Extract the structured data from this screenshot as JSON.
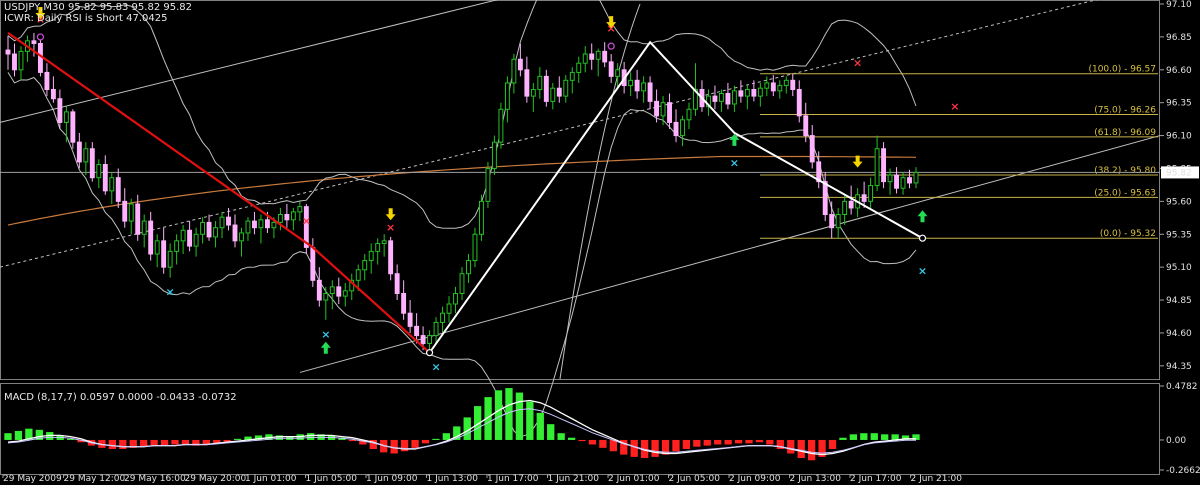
{
  "header": {
    "symbol_line": "USDJPY,M30  95.82 95.83 95.82 95.82",
    "rsi_line": "ICWR: Daily RSI is Short 47.0425"
  },
  "macd_label": "MACD  (8,17,7) 0.0597 0.0000 -0.0433 -0.0732",
  "colors": {
    "background": "#000000",
    "candle_up": "#22c322",
    "candle_down": "#ffb3ff",
    "wave_red": "#e01010",
    "wave_white": "#ffffff",
    "fib_line": "#c8b44a",
    "moving_average": "#c87a3c",
    "bollinger": "#c0c0c0",
    "macd_up": "#33ee33",
    "macd_down": "#ff2020",
    "current_price": "#ffffff"
  },
  "chart_data": [
    {
      "type": "candlestick",
      "title": "USDJPY,M30",
      "ylim": [
        94.25,
        97.1
      ],
      "y_ticks": [
        "97.10",
        "96.85",
        "96.60",
        "96.35",
        "96.10",
        "95.85",
        "95.60",
        "95.35",
        "95.10",
        "94.85",
        "94.60",
        "94.35"
      ],
      "x_ticks": [
        "29 May 2009",
        "29 May 12:00",
        "29 May 16:00",
        "29 May 20:00",
        "1 Jun 01:00",
        "1 Jun 05:00",
        "1 Jun 09:00",
        "1 Jun 13:00",
        "1 Jun 17:00",
        "1 Jun 21:00",
        "2 Jun 01:00",
        "2 Jun 05:00",
        "2 Jun 09:00",
        "2 Jun 13:00",
        "2 Jun 17:00",
        "2 Jun 21:00"
      ],
      "current_price": 95.82,
      "current_price_label": "95.82",
      "fibonacci_levels": [
        {
          "label": "(100.0) - 96.57",
          "value": 96.57
        },
        {
          "label": "(75.0) - 96.26",
          "value": 96.26
        },
        {
          "label": "(61.8) - 96.09",
          "value": 96.09
        },
        {
          "label": "(38.2) - 95.80",
          "value": 95.8
        },
        {
          "label": "(25.0) - 95.63",
          "value": 95.63
        },
        {
          "label": "(0.0) - 95.32",
          "value": 95.32
        }
      ],
      "zigzag_red": [
        [
          0,
          96.88
        ],
        [
          47,
          95.25
        ],
        [
          65,
          94.45
        ]
      ],
      "zigzag_white": [
        [
          65,
          94.45
        ],
        [
          99,
          96.81
        ],
        [
          112,
          96.12
        ],
        [
          141,
          95.32
        ]
      ],
      "swing_highs": [
        [
          5,
          96.88
        ],
        [
          46,
          95.35
        ],
        [
          59,
          95.3
        ],
        [
          93,
          96.81
        ],
        [
          131,
          96.55
        ],
        [
          146,
          96.22
        ]
      ],
      "swing_lows": [
        [
          25,
          95.02
        ],
        [
          49,
          94.7
        ],
        [
          66,
          94.45
        ],
        [
          112,
          96.0
        ],
        [
          141,
          95.18
        ]
      ],
      "arrows_down": [
        5,
        59,
        93,
        131
      ],
      "arrows_up": [
        49,
        112,
        141
      ],
      "ohlc": [
        [
          96.75,
          96.86,
          96.6,
          96.72
        ],
        [
          96.72,
          96.8,
          96.55,
          96.6
        ],
        [
          96.6,
          96.78,
          96.52,
          96.74
        ],
        [
          96.74,
          96.86,
          96.66,
          96.82
        ],
        [
          96.82,
          96.88,
          96.7,
          96.8
        ],
        [
          96.8,
          96.85,
          96.55,
          96.58
        ],
        [
          96.58,
          96.65,
          96.4,
          96.45
        ],
        [
          96.45,
          96.55,
          96.35,
          96.38
        ],
        [
          96.38,
          96.45,
          96.15,
          96.2
        ],
        [
          96.2,
          96.32,
          96.05,
          96.28
        ],
        [
          96.28,
          96.3,
          96.0,
          96.05
        ],
        [
          96.05,
          96.12,
          95.85,
          95.9
        ],
        [
          95.9,
          96.05,
          95.8,
          96.0
        ],
        [
          96.0,
          96.05,
          95.75,
          95.78
        ],
        [
          95.78,
          95.92,
          95.7,
          95.88
        ],
        [
          95.88,
          95.95,
          95.65,
          95.68
        ],
        [
          95.68,
          95.82,
          95.58,
          95.78
        ],
        [
          95.78,
          95.85,
          95.55,
          95.6
        ],
        [
          95.6,
          95.7,
          95.4,
          95.45
        ],
        [
          95.45,
          95.62,
          95.35,
          95.58
        ],
        [
          95.58,
          95.65,
          95.3,
          95.35
        ],
        [
          95.35,
          95.5,
          95.25,
          95.45
        ],
        [
          95.45,
          95.52,
          95.15,
          95.2
        ],
        [
          95.2,
          95.35,
          95.1,
          95.3
        ],
        [
          95.3,
          95.4,
          95.05,
          95.1
        ],
        [
          95.1,
          95.28,
          95.02,
          95.22
        ],
        [
          95.22,
          95.35,
          95.12,
          95.3
        ],
        [
          95.3,
          95.42,
          95.2,
          95.38
        ],
        [
          95.38,
          95.45,
          95.22,
          95.26
        ],
        [
          95.26,
          95.4,
          95.18,
          95.35
        ],
        [
          95.35,
          95.48,
          95.28,
          95.44
        ],
        [
          95.44,
          95.5,
          95.3,
          95.33
        ],
        [
          95.33,
          95.45,
          95.25,
          95.4
        ],
        [
          95.4,
          95.52,
          95.32,
          95.48
        ],
        [
          95.48,
          95.55,
          95.38,
          95.42
        ],
        [
          95.42,
          95.5,
          95.25,
          95.3
        ],
        [
          95.3,
          95.4,
          95.18,
          95.36
        ],
        [
          95.36,
          95.48,
          95.3,
          95.45
        ],
        [
          95.45,
          95.52,
          95.35,
          95.4
        ],
        [
          95.4,
          95.5,
          95.28,
          95.46
        ],
        [
          95.46,
          95.52,
          95.36,
          95.4
        ],
        [
          95.4,
          95.48,
          95.32,
          95.44
        ],
        [
          95.44,
          95.55,
          95.38,
          95.5
        ],
        [
          95.5,
          95.58,
          95.4,
          95.46
        ],
        [
          95.46,
          95.55,
          95.38,
          95.52
        ],
        [
          95.52,
          95.6,
          95.45,
          95.56
        ],
        [
          95.56,
          95.58,
          95.2,
          95.25
        ],
        [
          95.25,
          95.32,
          94.95,
          95.0
        ],
        [
          95.0,
          95.1,
          94.8,
          94.85
        ],
        [
          94.85,
          94.95,
          94.7,
          94.9
        ],
        [
          94.9,
          95.0,
          94.78,
          94.95
        ],
        [
          94.95,
          95.02,
          94.82,
          94.88
        ],
        [
          94.88,
          94.98,
          94.8,
          94.92
        ],
        [
          94.92,
          95.05,
          94.85,
          95.0
        ],
        [
          95.0,
          95.12,
          94.92,
          95.08
        ],
        [
          95.08,
          95.2,
          95.0,
          95.15
        ],
        [
          95.15,
          95.28,
          95.05,
          95.22
        ],
        [
          95.22,
          95.32,
          95.12,
          95.28
        ],
        [
          95.28,
          95.35,
          95.18,
          95.3
        ],
        [
          95.3,
          95.33,
          95.0,
          95.05
        ],
        [
          95.05,
          95.12,
          94.85,
          94.9
        ],
        [
          94.9,
          95.0,
          94.7,
          94.75
        ],
        [
          94.75,
          94.85,
          94.6,
          94.65
        ],
        [
          94.65,
          94.75,
          94.52,
          94.58
        ],
        [
          94.58,
          94.65,
          94.47,
          94.52
        ],
        [
          94.52,
          94.62,
          94.45,
          94.58
        ],
        [
          94.58,
          94.72,
          94.52,
          94.68
        ],
        [
          94.68,
          94.8,
          94.6,
          94.75
        ],
        [
          94.75,
          94.88,
          94.68,
          94.82
        ],
        [
          94.82,
          94.95,
          94.75,
          94.9
        ],
        [
          94.9,
          95.1,
          94.85,
          95.05
        ],
        [
          95.05,
          95.2,
          94.98,
          95.15
        ],
        [
          95.15,
          95.4,
          95.1,
          95.35
        ],
        [
          95.35,
          95.65,
          95.3,
          95.6
        ],
        [
          95.6,
          95.9,
          95.55,
          95.85
        ],
        [
          95.85,
          96.1,
          95.8,
          96.05
        ],
        [
          96.05,
          96.35,
          96.0,
          96.3
        ],
        [
          96.3,
          96.55,
          96.2,
          96.5
        ],
        [
          96.5,
          96.72,
          96.42,
          96.68
        ],
        [
          96.68,
          96.8,
          96.55,
          96.6
        ],
        [
          96.6,
          96.7,
          96.35,
          96.4
        ],
        [
          96.4,
          96.5,
          96.28,
          96.45
        ],
        [
          96.45,
          96.62,
          96.38,
          96.55
        ],
        [
          96.55,
          96.6,
          96.32,
          96.36
        ],
        [
          96.36,
          96.5,
          96.3,
          96.46
        ],
        [
          96.46,
          96.55,
          96.35,
          96.4
        ],
        [
          96.4,
          96.56,
          96.35,
          96.52
        ],
        [
          96.52,
          96.62,
          96.42,
          96.58
        ],
        [
          96.58,
          96.7,
          96.5,
          96.65
        ],
        [
          96.65,
          96.78,
          96.58,
          96.72
        ],
        [
          96.72,
          96.8,
          96.6,
          96.68
        ],
        [
          96.68,
          96.76,
          96.55,
          96.74
        ],
        [
          96.74,
          96.81,
          96.62,
          96.66
        ],
        [
          96.66,
          96.72,
          96.5,
          96.55
        ],
        [
          96.55,
          96.65,
          96.45,
          96.6
        ],
        [
          96.6,
          96.66,
          96.42,
          96.48
        ],
        [
          96.48,
          96.58,
          96.4,
          96.52
        ],
        [
          96.52,
          96.6,
          96.38,
          96.44
        ],
        [
          96.44,
          96.55,
          96.35,
          96.5
        ],
        [
          96.5,
          96.55,
          96.3,
          96.36
        ],
        [
          96.36,
          96.45,
          96.2,
          96.25
        ],
        [
          96.25,
          96.4,
          96.18,
          96.35
        ],
        [
          96.35,
          96.42,
          96.15,
          96.2
        ],
        [
          96.2,
          96.3,
          96.05,
          96.1
        ],
        [
          96.1,
          96.25,
          96.02,
          96.22
        ],
        [
          96.22,
          96.35,
          96.15,
          96.3
        ],
        [
          96.3,
          96.65,
          96.25,
          96.45
        ],
        [
          96.45,
          96.52,
          96.28,
          96.32
        ],
        [
          96.32,
          96.45,
          96.25,
          96.4
        ],
        [
          96.4,
          96.48,
          96.3,
          96.36
        ],
        [
          96.36,
          96.45,
          96.28,
          96.42
        ],
        [
          96.42,
          96.5,
          96.3,
          96.34
        ],
        [
          96.34,
          96.48,
          96.28,
          96.44
        ],
        [
          96.44,
          96.52,
          96.35,
          96.4
        ],
        [
          96.4,
          96.48,
          96.3,
          96.45
        ],
        [
          96.45,
          96.52,
          96.36,
          96.4
        ],
        [
          96.4,
          96.5,
          96.32,
          96.46
        ],
        [
          96.46,
          96.55,
          96.4,
          96.5
        ],
        [
          96.5,
          96.56,
          96.4,
          96.44
        ],
        [
          96.44,
          96.52,
          96.38,
          96.48
        ],
        [
          96.48,
          96.55,
          96.42,
          96.52
        ],
        [
          96.52,
          96.57,
          96.4,
          96.45
        ],
        [
          96.45,
          96.52,
          96.2,
          96.25
        ],
        [
          96.25,
          96.35,
          96.05,
          96.1
        ],
        [
          96.1,
          96.18,
          95.85,
          95.9
        ],
        [
          95.9,
          95.98,
          95.7,
          95.75
        ],
        [
          95.75,
          95.82,
          95.45,
          95.5
        ],
        [
          95.5,
          95.6,
          95.32,
          95.4
        ],
        [
          95.4,
          95.55,
          95.32,
          95.5
        ],
        [
          95.5,
          95.65,
          95.42,
          95.6
        ],
        [
          95.6,
          95.72,
          95.5,
          95.55
        ],
        [
          95.55,
          95.7,
          95.48,
          95.65
        ],
        [
          95.65,
          95.75,
          95.55,
          95.6
        ],
        [
          95.6,
          95.78,
          95.55,
          95.72
        ],
        [
          95.72,
          96.1,
          95.68,
          96.0
        ],
        [
          96.0,
          96.05,
          95.7,
          95.75
        ],
        [
          95.75,
          95.85,
          95.65,
          95.8
        ],
        [
          95.8,
          95.86,
          95.66,
          95.7
        ],
        [
          95.7,
          95.82,
          95.65,
          95.78
        ],
        [
          95.78,
          95.84,
          95.7,
          95.74
        ],
        [
          95.74,
          95.86,
          95.7,
          95.82
        ]
      ]
    },
    {
      "type": "bar",
      "title": "MACD  (8,17,7)",
      "ylim": [
        -0.2662,
        0.4782
      ],
      "y_ticks": [
        "0.4782",
        "0.00",
        "-0.2662"
      ],
      "histogram": [
        0.06,
        0.08,
        0.1,
        0.09,
        0.07,
        0.04,
        0.01,
        -0.02,
        -0.05,
        -0.07,
        -0.08,
        -0.08,
        -0.07,
        -0.06,
        -0.05,
        -0.05,
        -0.04,
        -0.04,
        -0.05,
        -0.04,
        -0.03,
        -0.02,
        0.01,
        0.03,
        0.04,
        0.05,
        0.04,
        0.03,
        0.05,
        0.06,
        0.05,
        0.04,
        0.02,
        -0.01,
        -0.04,
        -0.08,
        -0.11,
        -0.12,
        -0.1,
        -0.07,
        -0.03,
        0.01,
        0.06,
        0.12,
        0.2,
        0.3,
        0.38,
        0.44,
        0.46,
        0.42,
        0.34,
        0.24,
        0.14,
        0.06,
        0.02,
        -0.01,
        -0.04,
        -0.07,
        -0.1,
        -0.13,
        -0.15,
        -0.16,
        -0.15,
        -0.13,
        -0.1,
        -0.08,
        -0.06,
        -0.05,
        -0.04,
        -0.04,
        -0.03,
        -0.03,
        -0.02,
        -0.04,
        -0.08,
        -0.12,
        -0.16,
        -0.18,
        -0.15,
        -0.08,
        0.02,
        0.05,
        0.06,
        0.06,
        0.05,
        0.05,
        0.04,
        0.05
      ],
      "signal_line": [
        -0.02,
        -0.01,
        0.01,
        0.03,
        0.04,
        0.04,
        0.03,
        0.01,
        -0.02,
        -0.04,
        -0.05,
        -0.06,
        -0.06,
        -0.06,
        -0.05,
        -0.05,
        -0.05,
        -0.04,
        -0.04,
        -0.04,
        -0.03,
        -0.02,
        -0.01,
        0.0,
        0.01,
        0.02,
        0.03,
        0.03,
        0.03,
        0.04,
        0.04,
        0.04,
        0.03,
        0.02,
        0.0,
        -0.02,
        -0.05,
        -0.07,
        -0.08,
        -0.08,
        -0.06,
        -0.04,
        -0.01,
        0.03,
        0.08,
        0.14,
        0.2,
        0.26,
        0.31,
        0.34,
        0.35,
        0.33,
        0.29,
        0.24,
        0.19,
        0.14,
        0.09,
        0.05,
        0.01,
        -0.03,
        -0.06,
        -0.09,
        -0.11,
        -0.12,
        -0.12,
        -0.11,
        -0.1,
        -0.09,
        -0.08,
        -0.07,
        -0.06,
        -0.05,
        -0.05,
        -0.05,
        -0.06,
        -0.08,
        -0.1,
        -0.12,
        -0.13,
        -0.12,
        -0.1,
        -0.07,
        -0.04,
        -0.02,
        -0.01,
        0.0,
        0.01,
        0.01
      ]
    }
  ]
}
